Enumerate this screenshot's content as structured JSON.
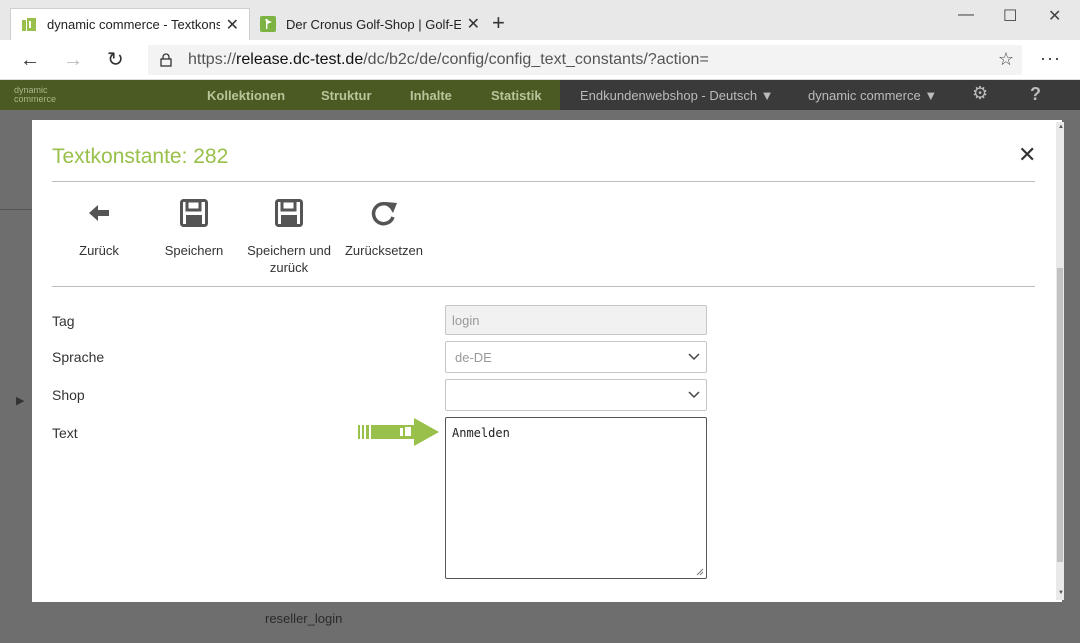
{
  "browser": {
    "tabs": [
      {
        "title": "dynamic commerce - Textkonsta",
        "active": true
      },
      {
        "title": "Der Cronus Golf-Shop | Golf-Equ",
        "active": false
      }
    ],
    "url_prefix": "https://",
    "url_domain": "release.dc-test.de",
    "url_path": "/dc/b2c/de/config/config_text_constants/?action=",
    "window_controls": {
      "minimize": "—",
      "maximize": "☐",
      "close": "✕"
    },
    "nav": {
      "back": "←",
      "forward": "→",
      "reload": "↻"
    },
    "more": "···"
  },
  "app_header": {
    "logo_line1": "dynamic",
    "logo_line2": "commerce",
    "nav_items": [
      "Kollektionen",
      "Struktur",
      "Inhalte",
      "Statistik"
    ],
    "shop_selector": "Endkundenwebshop - Deutsch",
    "company_selector": "dynamic commerce",
    "help": "?"
  },
  "background": {
    "row_text": "reseller_login"
  },
  "modal": {
    "title": "Textkonstante: 282",
    "toolbar": {
      "back_label": "Zurück",
      "save_label": "Speichern",
      "save_back_label_1": "Speichern und",
      "save_back_label_2": "zurück",
      "reset_label": "Zurücksetzen"
    },
    "form": {
      "tag_label": "Tag",
      "tag_value": "login",
      "language_label": "Sprache",
      "language_value": "de-DE",
      "shop_label": "Shop",
      "shop_value": "",
      "text_label": "Text",
      "text_value": "Anmelden"
    }
  },
  "colors": {
    "brand_green": "#98c04a",
    "header_green": "#4a5a22",
    "backdrop": "#6e6e6e"
  }
}
